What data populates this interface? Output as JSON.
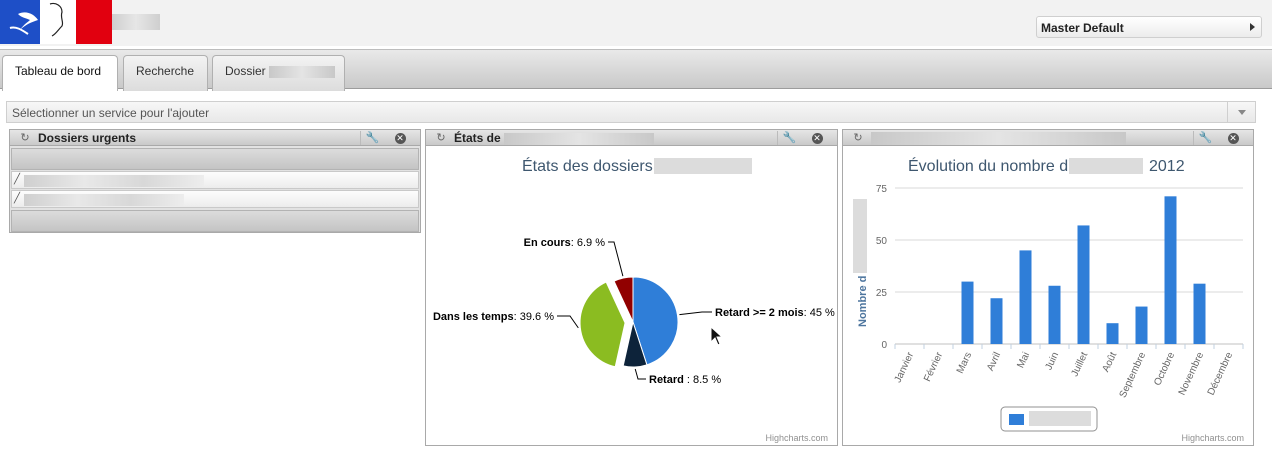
{
  "header": {
    "profile": {
      "label": "Master Default"
    }
  },
  "tabs": [
    {
      "label": "Tableau de bord",
      "active": true
    },
    {
      "label": "Recherche",
      "active": false
    },
    {
      "label": "Dossier",
      "active": false
    }
  ],
  "service_select": {
    "placeholder": "Sélectionner un service pour l'ajouter"
  },
  "portlets": {
    "urgent": {
      "title": "Dossiers urgents"
    },
    "states": {
      "title": "États de"
    },
    "evolution": {
      "title": ""
    }
  },
  "pie_chart": {
    "title": "États des dossiers",
    "credit": "Highcharts.com"
  },
  "bar_chart": {
    "title_prefix": "Évolution du nombre d'",
    "title_suffix": "2012",
    "ylabel": "Nombre d",
    "credit": "Highcharts.com"
  },
  "chart_data": [
    {
      "type": "pie",
      "title": "États des dossiers",
      "slices": [
        {
          "name": "Retard >= 2 mois",
          "value": 45,
          "label": "45 %",
          "color": "#2f7ed8"
        },
        {
          "name": "Retard",
          "value": 8.5,
          "label": "8.5 %",
          "color": "#0d233a"
        },
        {
          "name": "Dans les temps",
          "value": 39.6,
          "label": "39.6 %",
          "color": "#8bbc21"
        },
        {
          "name": "En cours",
          "value": 6.9,
          "label": "6.9 %",
          "color": "#910000"
        }
      ]
    },
    {
      "type": "bar",
      "title": "Évolution du nombre d' 2012",
      "ylabel": "Nombre d",
      "categories": [
        "Janvier",
        "Février",
        "Mars",
        "Avril",
        "Mai",
        "Juin",
        "Juillet",
        "Août",
        "Septembre",
        "Octobre",
        "Novembre",
        "Décembre"
      ],
      "series": [
        {
          "values": [
            0,
            0,
            30,
            22,
            45,
            28,
            57,
            10,
            18,
            71,
            29,
            0
          ],
          "color": "#2f7ed8"
        }
      ],
      "yticks": [
        0,
        25,
        50,
        75
      ],
      "ylim": [
        0,
        75
      ],
      "grid": true
    }
  ]
}
